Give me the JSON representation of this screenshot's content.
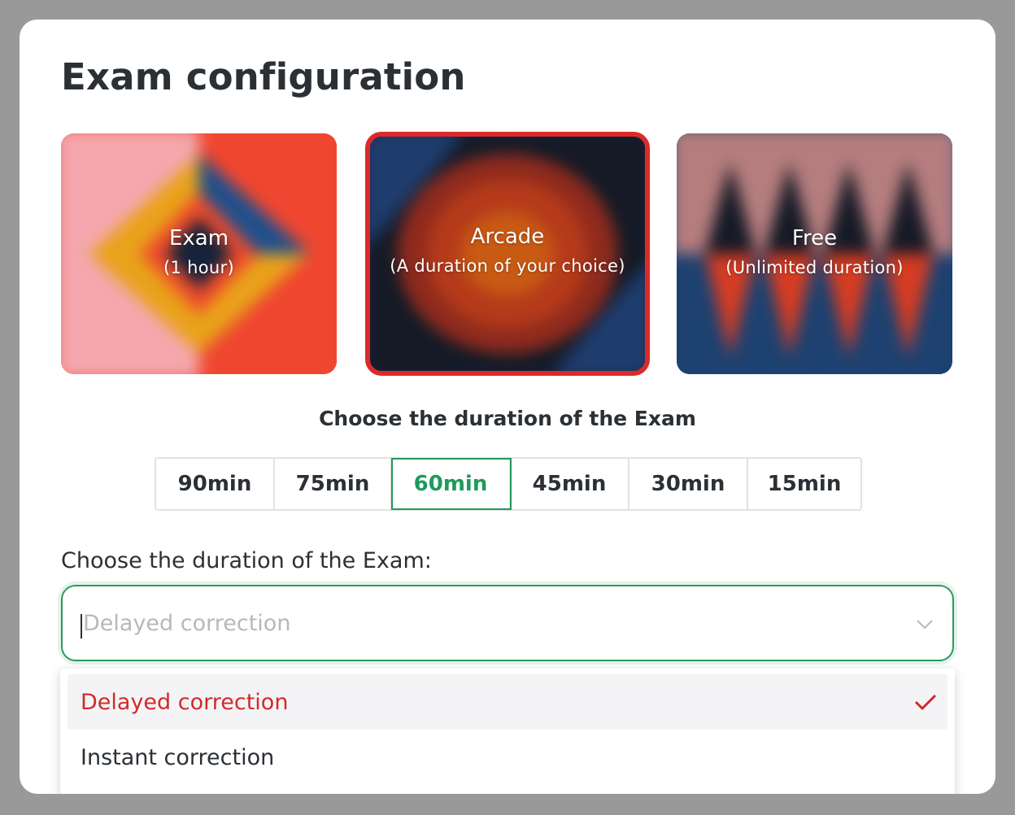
{
  "dialog": {
    "title": "Exam configuration"
  },
  "modes": [
    {
      "name": "Exam",
      "subtitle": "(1 hour)",
      "selected": false
    },
    {
      "name": "Arcade",
      "subtitle": "(A duration of your choice)",
      "selected": true
    },
    {
      "name": "Free",
      "subtitle": "(Unlimited duration)",
      "selected": false
    }
  ],
  "duration": {
    "heading": "Choose the duration of the Exam",
    "options": [
      "90min",
      "75min",
      "60min",
      "45min",
      "30min",
      "15min"
    ],
    "selected": "60min"
  },
  "correction": {
    "label": "Choose the duration of the Exam:",
    "placeholder": "Delayed correction",
    "options": [
      "Delayed correction",
      "Instant correction"
    ],
    "selected": "Delayed correction"
  },
  "colors": {
    "accent_green": "#239a5e",
    "accent_red": "#d22a2a"
  },
  "icons": {
    "dropdown": "chevron-down-icon",
    "selected_option": "check-icon"
  }
}
